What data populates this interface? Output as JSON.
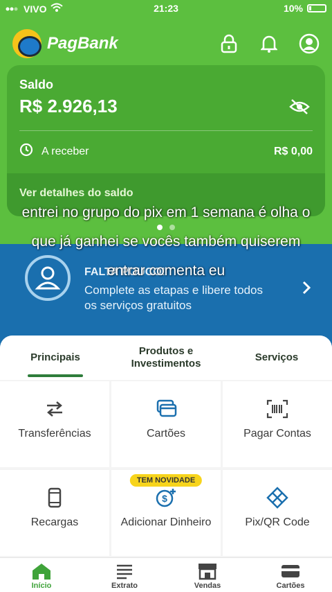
{
  "status_bar": {
    "carrier": "VIVO",
    "time": "21:23",
    "battery": "10%"
  },
  "header": {
    "brand": "PagBank"
  },
  "balance_card": {
    "label": "Saldo",
    "value": "R$ 2.926,13",
    "receivable_label": "A receber",
    "receivable_value": "R$ 0,00",
    "details_link": "Ver detalhes do saldo"
  },
  "promo": {
    "title": "FALTA POUCO!",
    "text": "Complete as etapas e libere todos os serviços gratuitos"
  },
  "tabs": [
    {
      "label": "Principais"
    },
    {
      "label": "Produtos e Investimentos"
    },
    {
      "label": "Serviços"
    }
  ],
  "grid": [
    {
      "label": "Transferências",
      "icon": "transfer-icon"
    },
    {
      "label": "Cartões",
      "icon": "cards-icon"
    },
    {
      "label": "Pagar Contas",
      "icon": "barcode-icon"
    },
    {
      "label": "Recargas",
      "icon": "phone-icon"
    },
    {
      "label": "Adicionar Dinheiro",
      "icon": "add-money-icon",
      "badge": "TEM NOVIDADE"
    },
    {
      "label": "Pix/QR Code",
      "icon": "pix-icon"
    }
  ],
  "bottom_nav": [
    {
      "label": "Início",
      "icon": "home-icon"
    },
    {
      "label": "Extrato",
      "icon": "statement-icon"
    },
    {
      "label": "Vendas",
      "icon": "store-icon"
    },
    {
      "label": "Cartões",
      "icon": "card-icon"
    }
  ],
  "overlay_caption": "entrei no grupo do pix em 1 semana é olha o que já ganhei se vocês também quiserem entrar comenta eu",
  "colors": {
    "green": "#5cbf3f",
    "card_green": "#4aaa33",
    "promo_blue": "#1a6fae",
    "badge_yellow": "#f7d41c",
    "active_nav": "#3fa33a"
  }
}
